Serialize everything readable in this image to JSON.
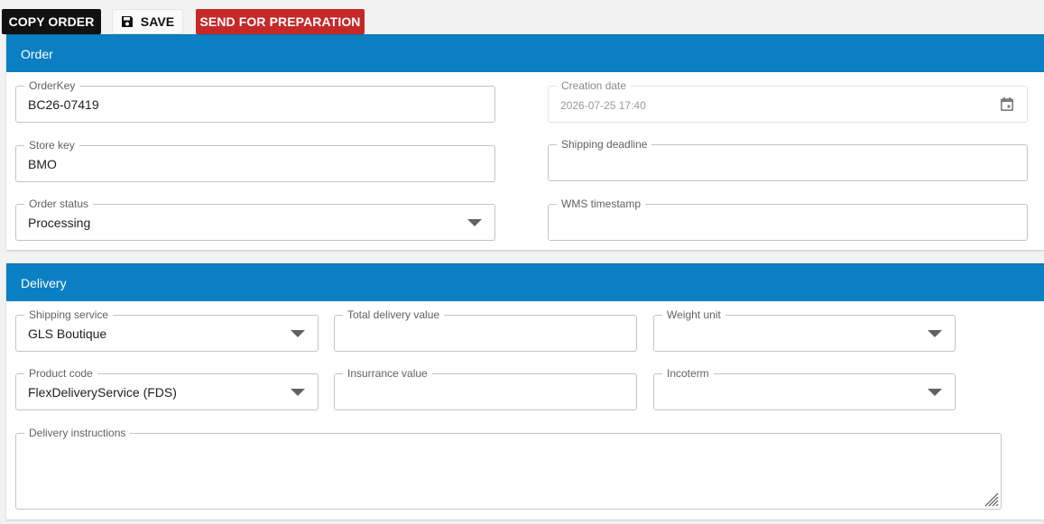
{
  "toolbar": {
    "copy_order_label": "COPY ORDER",
    "save_label": "SAVE",
    "send_label": "SEND FOR PREPARATION",
    "save_icon": "floppy-disk-icon"
  },
  "order": {
    "title": "Order",
    "order_key": {
      "label": "OrderKey",
      "value": "BC26-07419"
    },
    "creation_date": {
      "label": "Creation date",
      "value": "2026-07-25 17:40",
      "icon": "calendar-icon"
    },
    "store_key": {
      "label": "Store key",
      "value": "BMO"
    },
    "shipping_deadline": {
      "label": "Shipping deadline",
      "value": ""
    },
    "order_status": {
      "label": "Order status",
      "value": "Processing"
    },
    "wms_timestamp": {
      "label": "WMS timestamp",
      "value": ""
    }
  },
  "delivery": {
    "title": "Delivery",
    "shipping_service": {
      "label": "Shipping service",
      "value": "GLS Boutique"
    },
    "total_delivery_value": {
      "label": "Total delivery value",
      "value": ""
    },
    "weight_unit": {
      "label": "Weight unit",
      "value": ""
    },
    "product_code": {
      "label": "Product code",
      "value": "FlexDeliveryService (FDS)"
    },
    "insurrance_value": {
      "label": "Insurrance value",
      "value": ""
    },
    "incoterm": {
      "label": "Incoterm",
      "value": ""
    },
    "delivery_instructions": {
      "label": "Delivery instructions",
      "value": ""
    }
  },
  "colors": {
    "header_blue": "#0a7fc2",
    "send_red": "#c62828",
    "copy_black": "#111111"
  }
}
